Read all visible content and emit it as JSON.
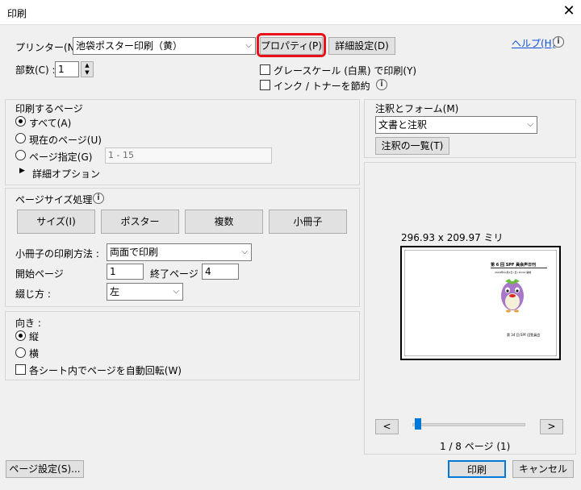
{
  "window": {
    "title": "印刷",
    "close_glyph": "✕"
  },
  "printer": {
    "label": "プリンター(N) :",
    "selected": "池袋ポスター印刷（黄）",
    "properties_label": "プロパティ(P)",
    "advanced_label": "詳細設定(D)",
    "help_label": "ヘルプ(H)",
    "copies_label": "部数(C) :",
    "copies_value": "1",
    "grayscale_label": "グレースケール (白黒) で印刷(Y)",
    "grayscale_checked": false,
    "save_ink_label": "インク / トナーを節約",
    "save_ink_checked": false,
    "highlight_color": "#e8111a"
  },
  "pages": {
    "heading": "印刷するページ",
    "all_label": "すべて(A)",
    "current_label": "現在のページ(U)",
    "range_label": "ページ指定(G)",
    "range_value": "1 - 15",
    "more_options_label": "詳細オプション",
    "selected": "all"
  },
  "sizing": {
    "heading": "ページサイズ処理",
    "buttons": [
      "サイズ(I)",
      "ポスター",
      "複数",
      "小冊子"
    ],
    "booklet_subset_label": "小冊子の印刷方法 :",
    "booklet_subset_value": "両面で印刷",
    "start_page_label": "開始ページ",
    "start_page_value": "1",
    "end_page_label": "終了ページ",
    "end_page_value": "4",
    "binding_label": "綴じ方 :",
    "binding_value": "左"
  },
  "orientation": {
    "heading": "向き :",
    "portrait_label": "縦",
    "landscape_label": "横",
    "selected": "portrait",
    "auto_rotate_label": "各シート内でページを自動回転(W)",
    "auto_rotate_checked": false
  },
  "comments": {
    "heading": "注釈とフォーム(M)",
    "selected": "文書と注釈",
    "summary_button": "注釈の一覧(T)"
  },
  "preview": {
    "size_label": "296.93 x 209.97 ミリ",
    "prev_label": "<",
    "next_label": ">",
    "page_indicator": "1 / 8 ページ (1)",
    "slider_position": 0,
    "thumb_title": "第 6 回 SPF 員会声日刊",
    "thumb_sub": "2016年10月2日 (日) 10:00 開催",
    "thumb_footer": "第 34 回 SPF 回覧員会"
  },
  "footer": {
    "page_setup_label": "ページ設定(S)...",
    "print_label": "印刷",
    "cancel_label": "キャンセル"
  }
}
